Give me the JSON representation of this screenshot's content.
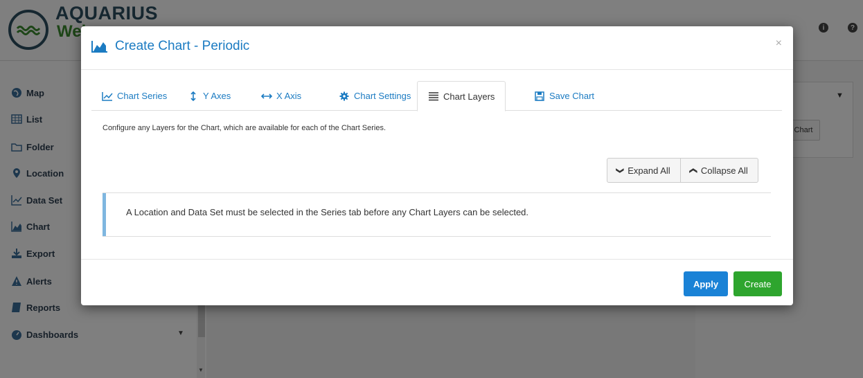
{
  "app": {
    "logo_text": "AQUARIUS",
    "logo_sub": "Web",
    "header_icons": [
      "info-icon",
      "help-icon"
    ]
  },
  "sidebar": {
    "items": [
      {
        "label": "Map",
        "icon": "globe-icon"
      },
      {
        "label": "List",
        "icon": "table-icon"
      },
      {
        "label": "Folder",
        "icon": "folder-icon"
      },
      {
        "label": "Location",
        "icon": "map-marker-icon"
      },
      {
        "label": "Data Set",
        "icon": "line-chart-icon"
      },
      {
        "label": "Chart",
        "icon": "area-chart-icon"
      },
      {
        "label": "Export",
        "icon": "download-icon"
      },
      {
        "label": "Alerts",
        "icon": "warning-icon"
      },
      {
        "label": "Reports",
        "icon": "book-icon"
      },
      {
        "label": "Dashboards",
        "icon": "dashboard-icon"
      }
    ]
  },
  "right_panel": {
    "button_label": "Chart"
  },
  "modal": {
    "title": "Create Chart - Periodic",
    "close": "×",
    "tabs": [
      {
        "label": "Chart Series",
        "icon": "line-chart-icon"
      },
      {
        "label": "Y Axes",
        "icon": "arrows-vertical-icon"
      },
      {
        "label": "X Axis",
        "icon": "arrows-horizontal-icon"
      },
      {
        "label": "Chart Settings",
        "icon": "gear-icon"
      },
      {
        "label": "Chart Layers",
        "icon": "list-icon",
        "active": true
      },
      {
        "label": "Save Chart",
        "icon": "save-icon"
      }
    ],
    "description": "Configure any Layers for the Chart, which are available for each of the Chart Series.",
    "expand_all": "Expand All",
    "collapse_all": "Collapse All",
    "alert_message": "A Location and Data Set must be selected in the Series tab before any Chart Layers can be selected.",
    "apply_label": "Apply",
    "create_label": "Create"
  },
  "colors": {
    "accent": "#1b7bc2",
    "apply": "#1a82d6",
    "create": "#2ea52e",
    "alert_bar": "#7fb7e0"
  }
}
